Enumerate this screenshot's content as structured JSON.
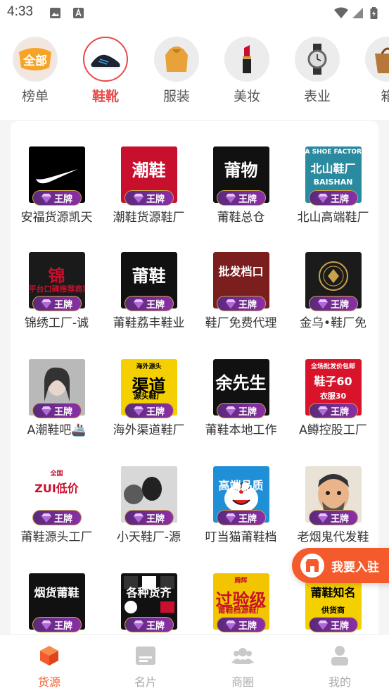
{
  "status": {
    "time": "4:33"
  },
  "categories": [
    {
      "label": "榜单",
      "icon": "all-badge-icon",
      "badge_text": "全部",
      "active": false
    },
    {
      "label": "鞋靴",
      "icon": "sneaker-icon",
      "active": true
    },
    {
      "label": "服装",
      "icon": "hoodie-icon",
      "active": false
    },
    {
      "label": "美妆",
      "icon": "lipstick-icon",
      "active": false
    },
    {
      "label": "表业",
      "icon": "watch-icon",
      "active": false
    },
    {
      "label": "箱",
      "icon": "bag-icon",
      "active": false
    }
  ],
  "badge_label": "王牌",
  "sellers": [
    {
      "name": "安福货源凯天",
      "thumb_text": "",
      "thumb_style": "nike"
    },
    {
      "name": "潮鞋货源鞋厂",
      "thumb_text": "潮鞋",
      "thumb_style": "red"
    },
    {
      "name": "莆鞋总仓",
      "thumb_text": "莆物",
      "thumb_style": "black"
    },
    {
      "name": "北山高端鞋厂",
      "thumb_text": "北山鞋厂",
      "thumb_sub": "BAISHAN",
      "thumb_top": "A SHOE FACTORY",
      "thumb_style": "teal"
    },
    {
      "name": "锦绣工厂-诚",
      "thumb_text": "锦",
      "thumb_sub": "平台口碑推荐商家",
      "thumb_style": "jinxiu"
    },
    {
      "name": "莆鞋荔丰鞋业",
      "thumb_text": "莆鞋",
      "thumb_style": "puxie"
    },
    {
      "name": "鞋厂免费代理",
      "thumb_text": "批发档口",
      "thumb_style": "poster"
    },
    {
      "name": "金乌•鞋厂免",
      "thumb_text": "",
      "thumb_style": "gold"
    },
    {
      "name": "A潮鞋吧🚢",
      "thumb_text": "",
      "thumb_style": "photo"
    },
    {
      "name": "海外渠道鞋厂",
      "thumb_text": "渠道",
      "thumb_top": "海外源头",
      "thumb_sub": "源头鞋厂",
      "thumb_style": "yellow"
    },
    {
      "name": "莆鞋本地工作",
      "thumb_text": "余先生",
      "thumb_style": "black2"
    },
    {
      "name": "A鳟控股工厂",
      "thumb_text": "鞋子60",
      "thumb_top": "全场批发价包邮",
      "thumb_sub": "衣服30",
      "thumb_style": "redtext"
    },
    {
      "name": "莆鞋源头工厂",
      "thumb_text": "ZUI低价",
      "thumb_top": "全国",
      "thumb_style": "zui"
    },
    {
      "name": "小天鞋厂-源",
      "thumb_text": "",
      "thumb_style": "bw"
    },
    {
      "name": "叮当猫莆鞋档",
      "thumb_text": "高端品质",
      "thumb_style": "dora"
    },
    {
      "name": "老烟鬼代发鞋",
      "thumb_text": "",
      "thumb_style": "cartoon"
    },
    {
      "name": "",
      "thumb_text": "烟货莆鞋",
      "thumb_style": "black3"
    },
    {
      "name": "",
      "thumb_text": "各种货齐",
      "thumb_style": "logos"
    },
    {
      "name": "",
      "thumb_text": "过验级",
      "thumb_top": "腾辉",
      "thumb_sub": "莆鞋档源鞋厂",
      "thumb_style": "tenghui"
    },
    {
      "name": "",
      "thumb_text": "莆鞋知名",
      "thumb_sub": "供货商",
      "thumb_style": "yellow2"
    }
  ],
  "join": {
    "label": "我要入驻",
    "icon": "store-icon"
  },
  "tabs": [
    {
      "label": "货源",
      "icon": "cube-icon",
      "active": true
    },
    {
      "label": "名片",
      "icon": "card-icon",
      "active": false
    },
    {
      "label": "商圈",
      "icon": "group-icon",
      "active": false
    },
    {
      "label": "我的",
      "icon": "user-icon",
      "active": false
    }
  ],
  "colors": {
    "accent": "#f55a2c",
    "active_category": "#e84a4a",
    "badge": "#7b2d9a"
  }
}
